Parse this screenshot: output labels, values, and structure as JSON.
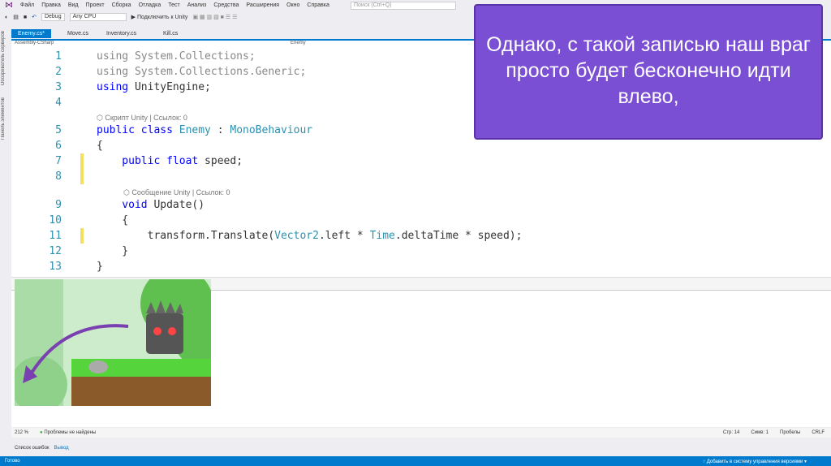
{
  "menu": [
    "Файл",
    "Правка",
    "Вид",
    "Проект",
    "Сборка",
    "Отладка",
    "Тест",
    "Анализ",
    "Средства",
    "Расширения",
    "Окно",
    "Справка"
  ],
  "search_placeholder": "Поиск (Ctrl+Q)",
  "toolbar": {
    "config": "Debug",
    "platform": "Any CPU",
    "run": "▶ Подключить к Unity"
  },
  "side_labels": [
    "Обозреватель серверов",
    "Панель элементов"
  ],
  "tabs": [
    "Enemy.cs*",
    "Move.cs",
    "Inventory.cs",
    "Kill.cs"
  ],
  "navbar": {
    "project": "Assembly-CSharp",
    "class": "Enemy"
  },
  "code": {
    "l1": "using System.Collections;",
    "l2": "using System.Collections.Generic;",
    "l3a": "using",
    "l3b": " UnityEngine;",
    "lens1": "⬡ Скрипт Unity | Ссылок: 0",
    "l5a": "public class ",
    "l5b": "Enemy",
    "l5c": " : ",
    "l5d": "MonoBehaviour",
    "l6": "{",
    "l7a": "    public float",
    "l7b": " speed;",
    "lens2": "⬡ Сообщение Unity | Ссылок: 0",
    "l9a": "    void",
    "l9b": " Update()",
    "l10": "    {",
    "l11a": "        transform.Translate(",
    "l11b": "Vector2",
    "l11c": ".left * ",
    "l11d": "Time",
    "l11e": ".deltaTime * speed);",
    "l12": "    }",
    "l13": "}"
  },
  "line_numbers": [
    "1",
    "2",
    "3",
    "4",
    "5",
    "6",
    "7",
    "8",
    "9",
    "10",
    "11",
    "12",
    "13"
  ],
  "status": {
    "zoom": "212 %",
    "problems": "Проблемы не найдены",
    "line": "Стр: 14",
    "col": "Симв: 1",
    "spaces": "Пробелы",
    "eol": "CRLF"
  },
  "bottom_tabs": [
    "Список ошибок",
    "Вывод"
  ],
  "bluebar": {
    "ready": "Готово",
    "vcs": "↑ Добавить в систему управления версиями ▾"
  },
  "callout": "Однако, с такой записью наш враг просто будет бесконечно идти влево,",
  "colors": {
    "accent": "#007acc",
    "callout": "#7b4fd4"
  }
}
